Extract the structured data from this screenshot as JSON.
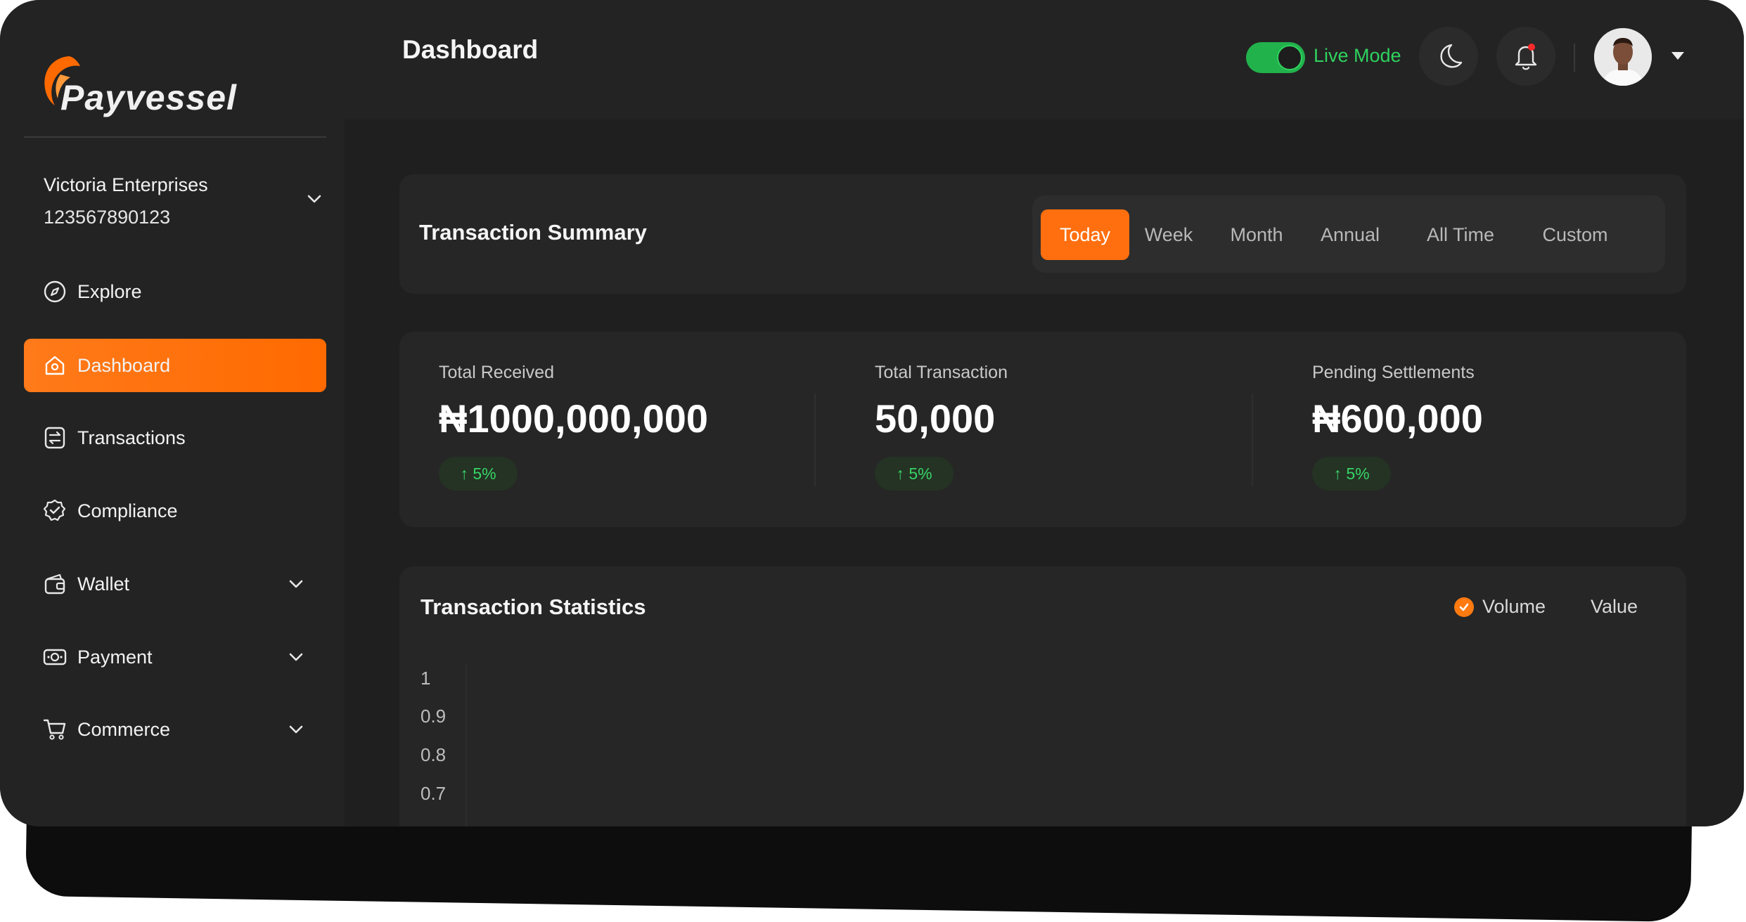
{
  "app": {
    "brand": "Payvessel"
  },
  "account": {
    "name": "Victoria Enterprises",
    "id": "123567890123"
  },
  "sidebar": {
    "items": [
      {
        "label": "Explore",
        "icon": "compass-icon",
        "active": false
      },
      {
        "label": "Dashboard",
        "icon": "home-icon",
        "active": true
      },
      {
        "label": "Transactions",
        "icon": "transfer-icon",
        "active": false
      },
      {
        "label": "Compliance",
        "icon": "badge-check-icon",
        "active": false
      },
      {
        "label": "Wallet",
        "icon": "wallet-icon",
        "active": false,
        "expandable": true
      },
      {
        "label": "Payment",
        "icon": "cash-icon",
        "active": false,
        "expandable": true
      },
      {
        "label": "Commerce",
        "icon": "cart-icon",
        "active": false,
        "expandable": true
      }
    ]
  },
  "header": {
    "title": "Dashboard",
    "live_mode_label": "Live Mode",
    "live_mode_on": true,
    "icons": [
      "moon-icon",
      "bell-icon"
    ]
  },
  "summary": {
    "title": "Transaction Summary",
    "tabs": [
      "Today",
      "Week",
      "Month",
      "Annual",
      "All Time",
      "Custom"
    ],
    "selected_tab": "Today"
  },
  "stats": [
    {
      "label": "Total Received",
      "value": "₦1000,000,000",
      "change": "5%"
    },
    {
      "label": "Total Transaction",
      "value": "50,000",
      "change": "5%"
    },
    {
      "label": "Pending Settlements",
      "value": "₦600,000",
      "change": "5%"
    }
  ],
  "statistics": {
    "title": "Transaction Statistics",
    "legend": {
      "volume": "Volume",
      "value": "Value",
      "volume_checked": true
    },
    "y_ticks": [
      "1",
      "0.9",
      "0.8",
      "0.7"
    ]
  },
  "colors": {
    "accent": "#ff6f0f",
    "positive": "#38d467",
    "live": "#2fd25e",
    "notification_dot": "#ff2a2a"
  }
}
